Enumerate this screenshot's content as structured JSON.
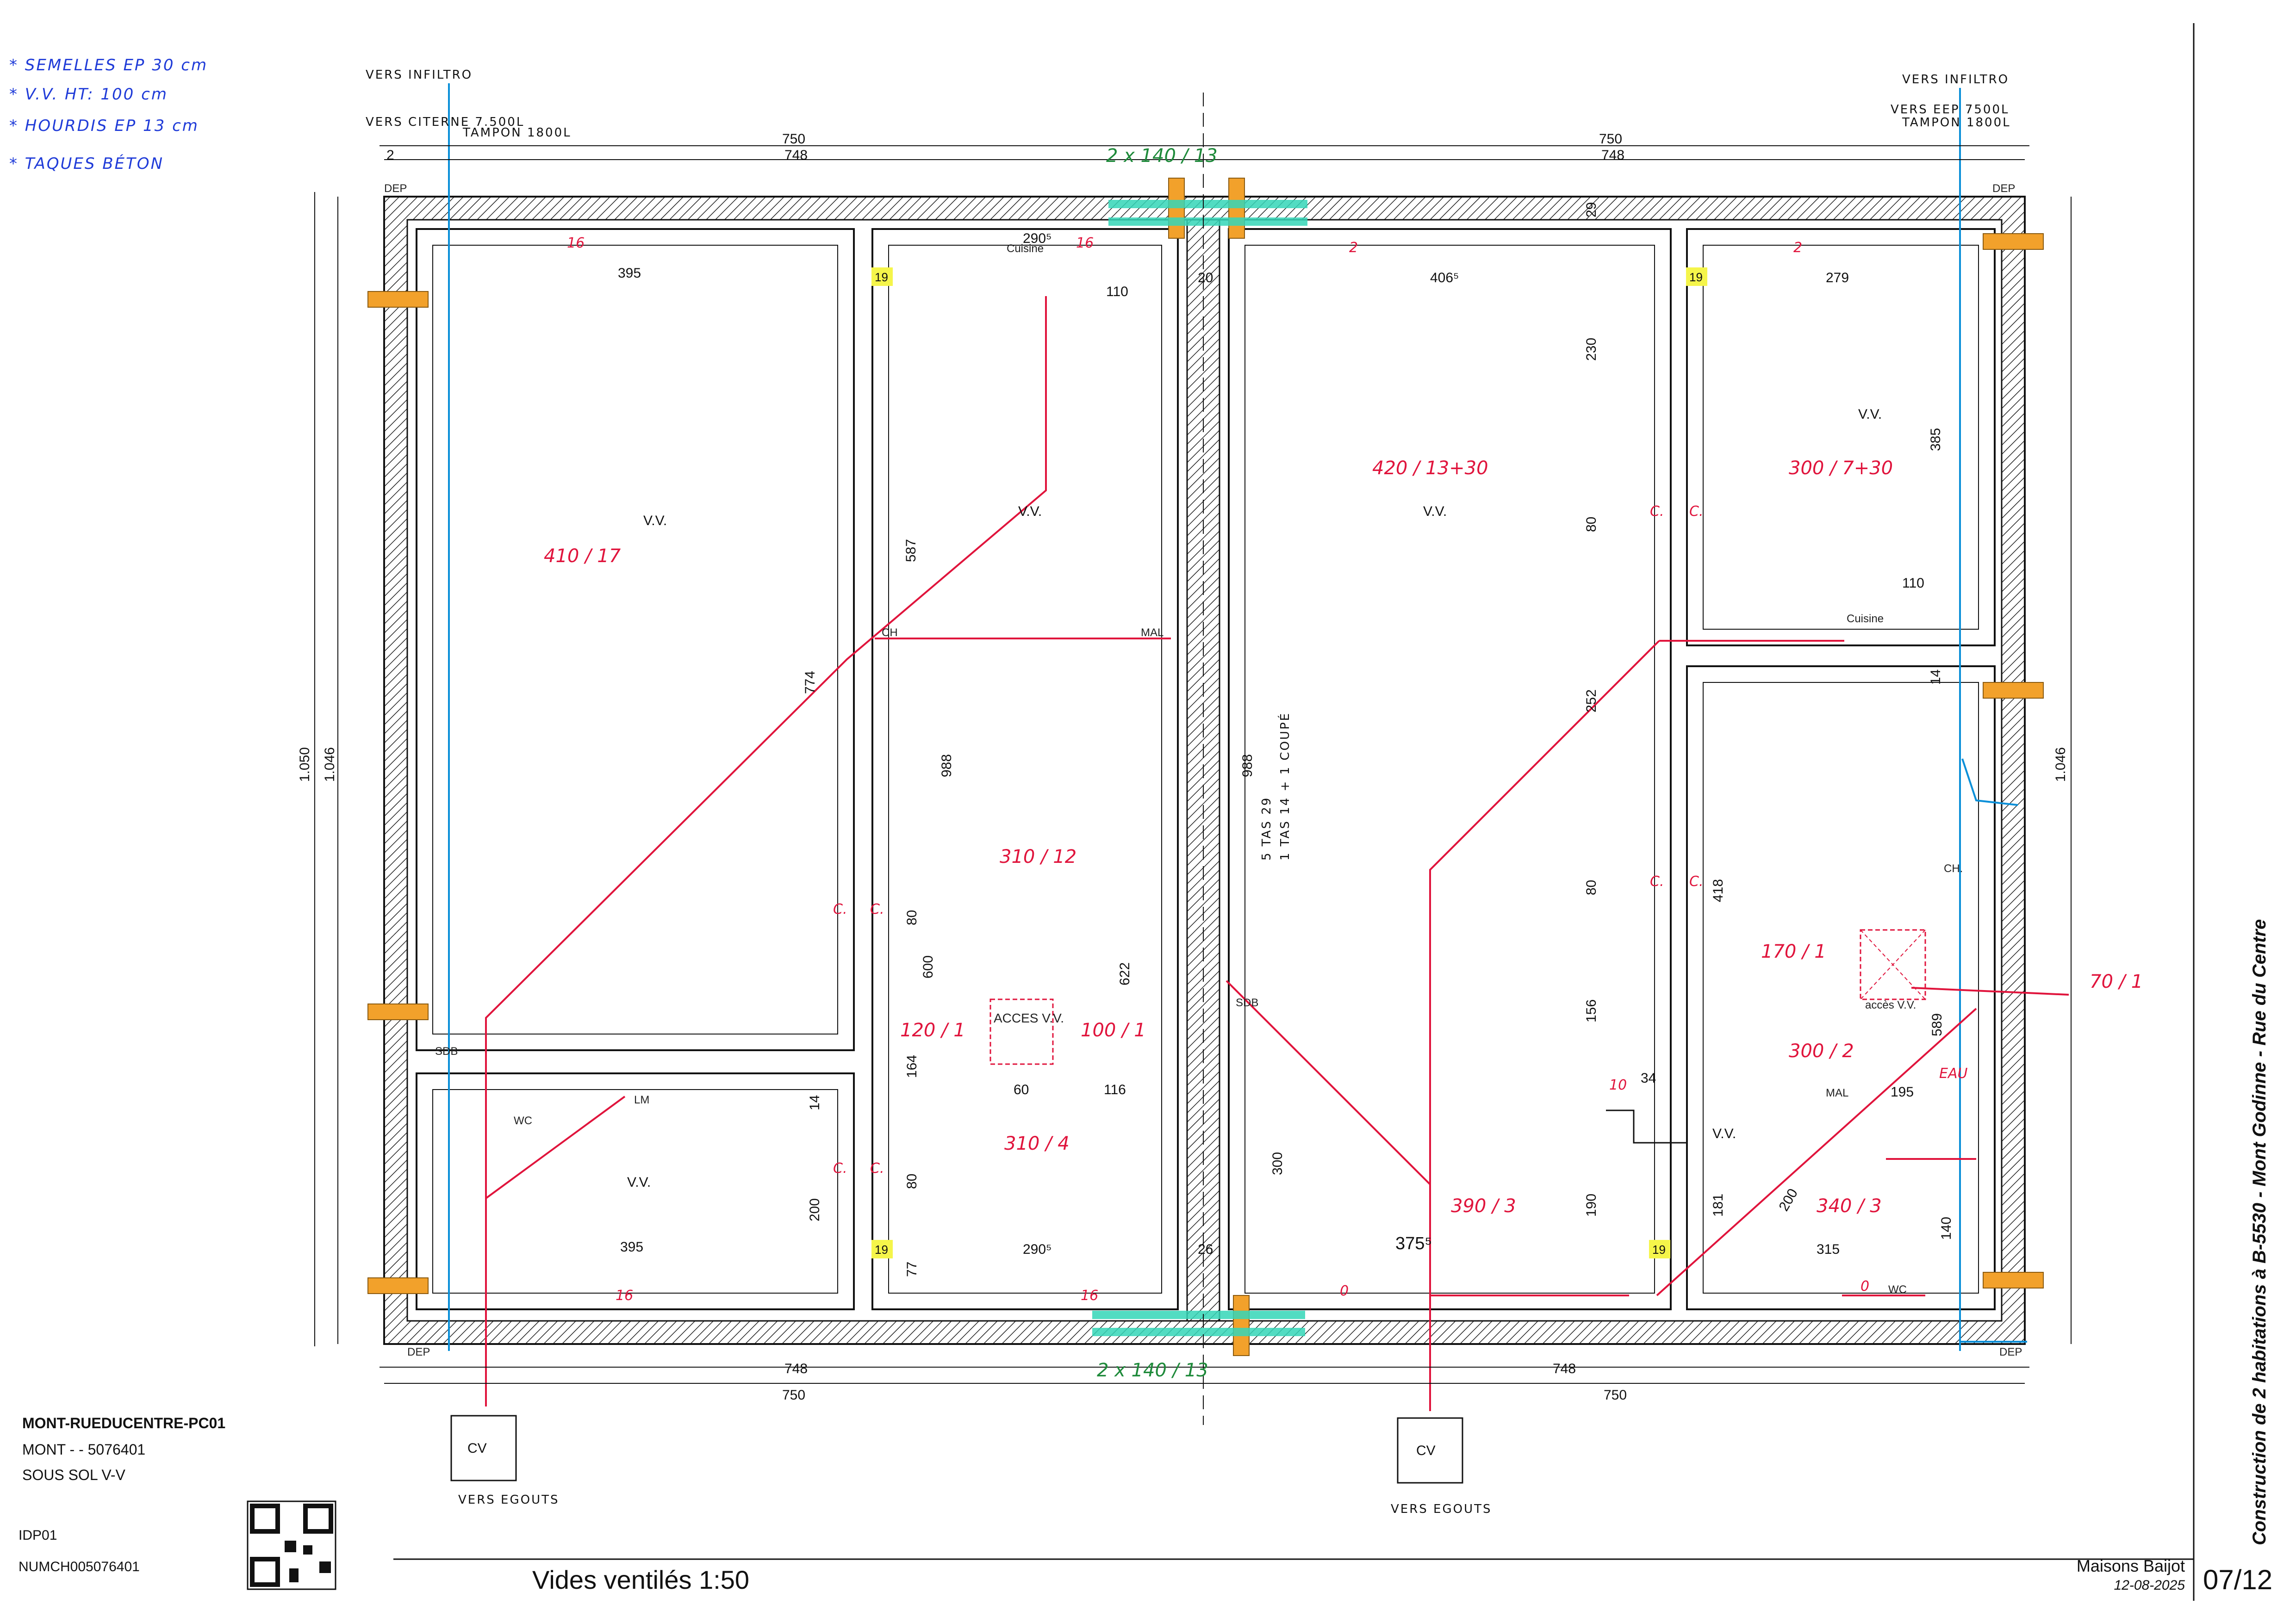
{
  "notes": [
    "* SEMELLES EP 30 cm",
    "* V.V. HT: 100 cm",
    "* HOURDIS EP 13 cm",
    "* TAQUES BÉTON"
  ],
  "flow_labels": {
    "left_infiltro": "VERS INFILTRO",
    "left_citerne": "VERS CITERNE 7.500L",
    "left_tampon": "TAMPON 1800L",
    "right_infiltro": "VERS INFILTRO",
    "right_eep": "VERS EEP 7500L",
    "right_tampon": "TAMPON 1800L",
    "egouts_left": "VERS EGOUTS",
    "egouts_right": "VERS EGOUTS",
    "cv": "CV"
  },
  "dimensions": {
    "top_750_left": "750",
    "top_748_left": "748",
    "top_750_right": "750",
    "top_748_right": "748",
    "top_2": "2",
    "hourdis_top": "2 x 140 / 13",
    "hourdis_bottom": "2 x 140 / 13",
    "bottom_748_left": "748",
    "bottom_750_left": "750",
    "bottom_748_right": "748",
    "bottom_750_right": "750",
    "height_1050": "1.050",
    "height_1046": "1.046",
    "height_1046_right": "1.046",
    "room_395_top": "395",
    "room_290_top": "290⁵",
    "room_406": "406⁵",
    "room_279": "279",
    "room_395_bottom": "395",
    "room_290_bottom": "290⁵",
    "room_375": "375⁵",
    "room_315": "315",
    "v_587": "587",
    "v_774": "774",
    "v_988": "988",
    "v_988b": "988",
    "v_230": "230",
    "v_80a": "80",
    "v_252": "252",
    "v_80b": "80",
    "v_156": "156",
    "v_190": "190",
    "v_385": "385",
    "v_14": "14",
    "v_418": "418",
    "v_181": "181",
    "v_200": "200",
    "v_14b": "14",
    "v_80c": "80",
    "v_600": "600",
    "v_164": "164",
    "v_80d": "80",
    "v_77": "77",
    "v_622": "622",
    "v_300": "300",
    "v_589": "589",
    "v_140": "140",
    "v_20": "20",
    "v_29": "29",
    "v_26": "26",
    "v_60": "60",
    "v_116": "116",
    "v_110a": "110",
    "v_110b": "110",
    "v_195": "195",
    "v_200b": "200",
    "v_34": "34"
  },
  "rooms": {
    "vv": "V.V.",
    "hourdis_a": "410 / 17",
    "hourdis_b": "310 / 12",
    "hourdis_c": "120 / 1",
    "hourdis_d": "100 / 1",
    "hourdis_e": "310 / 4",
    "hourdis_f": "420 / 13+30",
    "hourdis_g": "300 / 7+30",
    "hourdis_h": "170 / 1",
    "hourdis_i": "300 / 2",
    "hourdis_j": "390 / 3",
    "hourdis_k": "340 / 3",
    "hourdis_l": "70 / 1",
    "acces_vv": "ACCES V.V.",
    "acces_vv_small": "accès V.V.",
    "stas": "5 TAS 29",
    "stas2": "1 TAS 14 + 1 COUPÉ",
    "mark19": "19",
    "mark16": "16",
    "mark2": "2",
    "mark0": "0",
    "mark10": "10",
    "c_label": "C.",
    "ch": "CH.",
    "ch_left": "CH",
    "mal": "MAL",
    "sdb": "SDB",
    "sdb2": "SDB",
    "lm": "LM",
    "wc": "WC",
    "wc2": "WC",
    "cuisine": "Cuisine",
    "cuisine2": "Cuisine",
    "dep": "DEP",
    "eau": "EAU",
    "mal2": "MAL"
  },
  "cartouche": {
    "name": "MONT-RUEDUCENTRE-PC01",
    "ref": "MONT -  - 5076401",
    "level": "SOUS SOL V-V",
    "idp": "IDP01",
    "num": "NUMCH005076401",
    "title": "Vides ventilés 1:50",
    "company": "Maisons Baijot",
    "date": "12-08-2025",
    "page": "07/12",
    "project": "Construction de 2 habitations à B-5530 - Mont Godinne - Rue du Centre"
  },
  "colors": {
    "drain_red": "#e0143c",
    "water_blue": "#0a8fd8",
    "wall_hatch": "#222222",
    "support": "#f2a12b",
    "beam_cyan": "#35d6b8"
  }
}
